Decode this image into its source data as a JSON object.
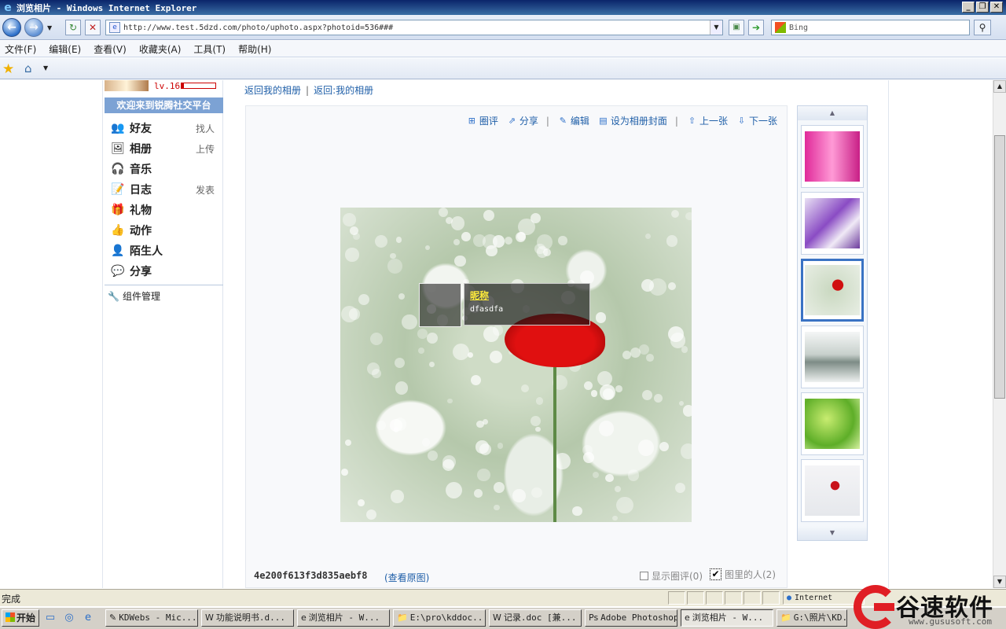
{
  "window": {
    "title": "浏览相片 - Windows Internet Explorer",
    "min": "_",
    "max": "❐",
    "close": "✕"
  },
  "nav": {
    "back_icon": "←",
    "forward_icon": "→",
    "refresh_icon": "↻",
    "stop_icon": "✕",
    "url": "http://www.test.5dzd.com/photo/uphoto.aspx?photoid=536###",
    "search_placeholder": "Bing",
    "go_icon": "➔",
    "search_btn_icon": "⚲",
    "dropdown_icon": "▼"
  },
  "menu": [
    "文件(F)",
    "编辑(E)",
    "查看(V)",
    "收藏夹(A)",
    "工具(T)",
    "帮助(H)"
  ],
  "sidebar": {
    "level": "lv.16",
    "welcome": "欢迎来到锐腾社交平台",
    "items": [
      {
        "label": "好友",
        "action": "找人",
        "icon": "friends-icon",
        "glyph": "👥"
      },
      {
        "label": "相册",
        "action": "上传",
        "icon": "album-icon",
        "glyph": "🖼"
      },
      {
        "label": "音乐",
        "action": "",
        "icon": "headphones-icon",
        "glyph": "🎧"
      },
      {
        "label": "日志",
        "action": "发表",
        "icon": "journal-icon",
        "glyph": "📝"
      },
      {
        "label": "礼物",
        "action": "",
        "icon": "gift-icon",
        "glyph": "🎁"
      },
      {
        "label": "动作",
        "action": "",
        "icon": "thumbs-up-icon",
        "glyph": "👍"
      },
      {
        "label": "陌生人",
        "action": "",
        "icon": "stranger-icon",
        "glyph": "👤"
      },
      {
        "label": "分享",
        "action": "",
        "icon": "share-icon",
        "glyph": "💬"
      }
    ],
    "widgets_label": "组件管理"
  },
  "crumbs": {
    "back_album": "返回我的相册",
    "back_prefix": "返回:我的相册"
  },
  "toolbar": {
    "comment": "圈评",
    "share": "分享",
    "edit": "编辑",
    "set_cover": "设为相册封面",
    "prev": "上一张",
    "next": "下一张"
  },
  "tag": {
    "nickname": "昵称",
    "name": "dfasdfa"
  },
  "photo": {
    "name": "4e200f613f3d835aebf8",
    "view_original": "(查看原图)",
    "show_comments": "显示圈评(0)",
    "people_in_photo": "图里的人(2)"
  },
  "thumbs": {
    "up_icon": "▲",
    "down_icon": "▼",
    "items": [
      {
        "name": "pink-light-thumb",
        "bg": "linear-gradient(90deg,#e02a9a,#ff9ad6,#c81f86)"
      },
      {
        "name": "purple-flower-thumb",
        "bg": "linear-gradient(135deg,#e8e0f4,#8a4cc4 45%,#f0eaf6 70%,#6b3a9c)"
      },
      {
        "name": "white-flowers-red-poppy-thumb",
        "bg": "radial-gradient(circle at 60% 40%,#d01010 0 12%,transparent 13%),radial-gradient(circle at 50% 50%,#c9d8c0,#e8eee4)"
      },
      {
        "name": "misty-mountains-thumb",
        "bg": "linear-gradient(#f4f6f6,#c8d0cc 45%,#7d8c86 60%,#eef1f0)"
      },
      {
        "name": "green-leaves-thumb",
        "bg": "radial-gradient(circle at 40% 40%,#c8ec70,#5eae28 60%,#d6f0a0)"
      },
      {
        "name": "red-rose-thumb",
        "bg": "radial-gradient(circle at 55% 40%,#c8121a 0 10%,transparent 11%),linear-gradient(#f4f4f6,#e6e8ec)"
      }
    ]
  },
  "status": {
    "text": "完成",
    "zone": "Internet"
  },
  "taskbar": {
    "start": "开始",
    "tasks": [
      {
        "label": "KDWebs - Mic...",
        "icon": "✎"
      },
      {
        "label": "功能说明书.d...",
        "icon": "W"
      },
      {
        "label": "浏览相片 - W...",
        "icon": "e"
      },
      {
        "label": "E:\\pro\\kddoc...",
        "icon": "📁"
      },
      {
        "label": "记录.doc [兼...",
        "icon": "W"
      },
      {
        "label": "Adobe Photoshop",
        "icon": "Ps"
      },
      {
        "label": "浏览相片 - W...",
        "icon": "e"
      },
      {
        "label": "G:\\照片\\KD...",
        "icon": "📁"
      }
    ]
  },
  "brand": {
    "name": "谷速软件",
    "site": "www.gususoft.com"
  },
  "colors": {
    "link": "#1f5fa8",
    "accent": "#7ca2d4",
    "selected_thumb": "#3a73c4",
    "brand_red": "#e01e24"
  }
}
